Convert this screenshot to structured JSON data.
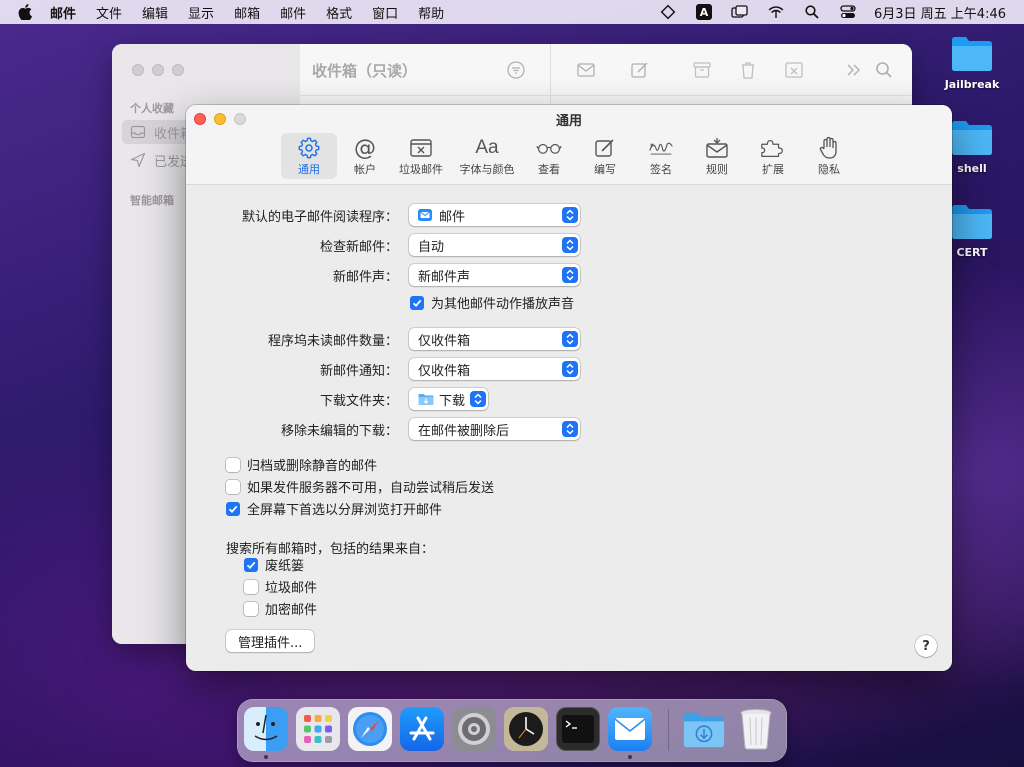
{
  "menubar": {
    "app_name": "邮件",
    "items": [
      "文件",
      "编辑",
      "显示",
      "邮箱",
      "邮件",
      "格式",
      "窗口",
      "帮助"
    ],
    "input_method": "A",
    "clock": "6月3日 周五 上午4:46"
  },
  "mail_window": {
    "title": "收件箱（只读）",
    "favorites_header": "个人收藏",
    "inbox_label": "收件箱",
    "sent_label": "已发送",
    "smart_header": "智能邮箱"
  },
  "prefs": {
    "title": "通用",
    "tabs": [
      {
        "label": "通用",
        "icon": "gear-icon"
      },
      {
        "label": "帐户",
        "icon": "at-sign-icon"
      },
      {
        "label": "垃圾邮件",
        "icon": "junk-tray-icon"
      },
      {
        "label": "字体与颜色",
        "icon": "font-icon"
      },
      {
        "label": "查看",
        "icon": "glasses-icon"
      },
      {
        "label": "编写",
        "icon": "compose-icon"
      },
      {
        "label": "签名",
        "icon": "signature-icon"
      },
      {
        "label": "规则",
        "icon": "rules-icon"
      },
      {
        "label": "扩展",
        "icon": "puzzle-icon"
      },
      {
        "label": "隐私",
        "icon": "hand-icon"
      }
    ],
    "default_reader_label": "默认的电子邮件阅读程序：",
    "default_reader_value": "邮件",
    "check_mail_label": "检查新邮件：",
    "check_mail_value": "自动",
    "new_sound_label": "新邮件声：",
    "new_sound_value": "新邮件声",
    "play_sounds_label": "为其他邮件动作播放声音",
    "play_sounds_checked": true,
    "dock_unread_label": "程序坞未读邮件数量：",
    "dock_unread_value": "仅收件箱",
    "notify_label": "新邮件通知：",
    "notify_value": "仅收件箱",
    "download_folder_label": "下载文件夹：",
    "download_folder_value": "下载",
    "remove_downloads_label": "移除未编辑的下载：",
    "remove_downloads_value": "在邮件被删除后",
    "archive_muted_label": "归档或删除静音的邮件",
    "archive_muted_checked": false,
    "retry_label": "如果发件服务器不可用，自动尝试稍后发送",
    "retry_checked": false,
    "split_view_label": "全屏幕下首选以分屏浏览打开邮件",
    "split_view_checked": true,
    "search_header": "搜索所有邮箱时，包括的结果来自：",
    "trash_label": "废纸篓",
    "trash_checked": true,
    "junk_label": "垃圾邮件",
    "junk_checked": false,
    "encrypted_label": "加密邮件",
    "encrypted_checked": false,
    "manage_button": "管理插件...",
    "help_button": "?"
  },
  "desktop": {
    "folders": [
      "Jailbreak",
      "shell",
      "CERT"
    ]
  },
  "dock": {
    "apps": [
      "Finder",
      "Launchpad",
      "Safari",
      "App Store",
      "System Preferences",
      "Clock",
      "Terminal",
      "Mail",
      "Downloads",
      "Trash"
    ]
  }
}
